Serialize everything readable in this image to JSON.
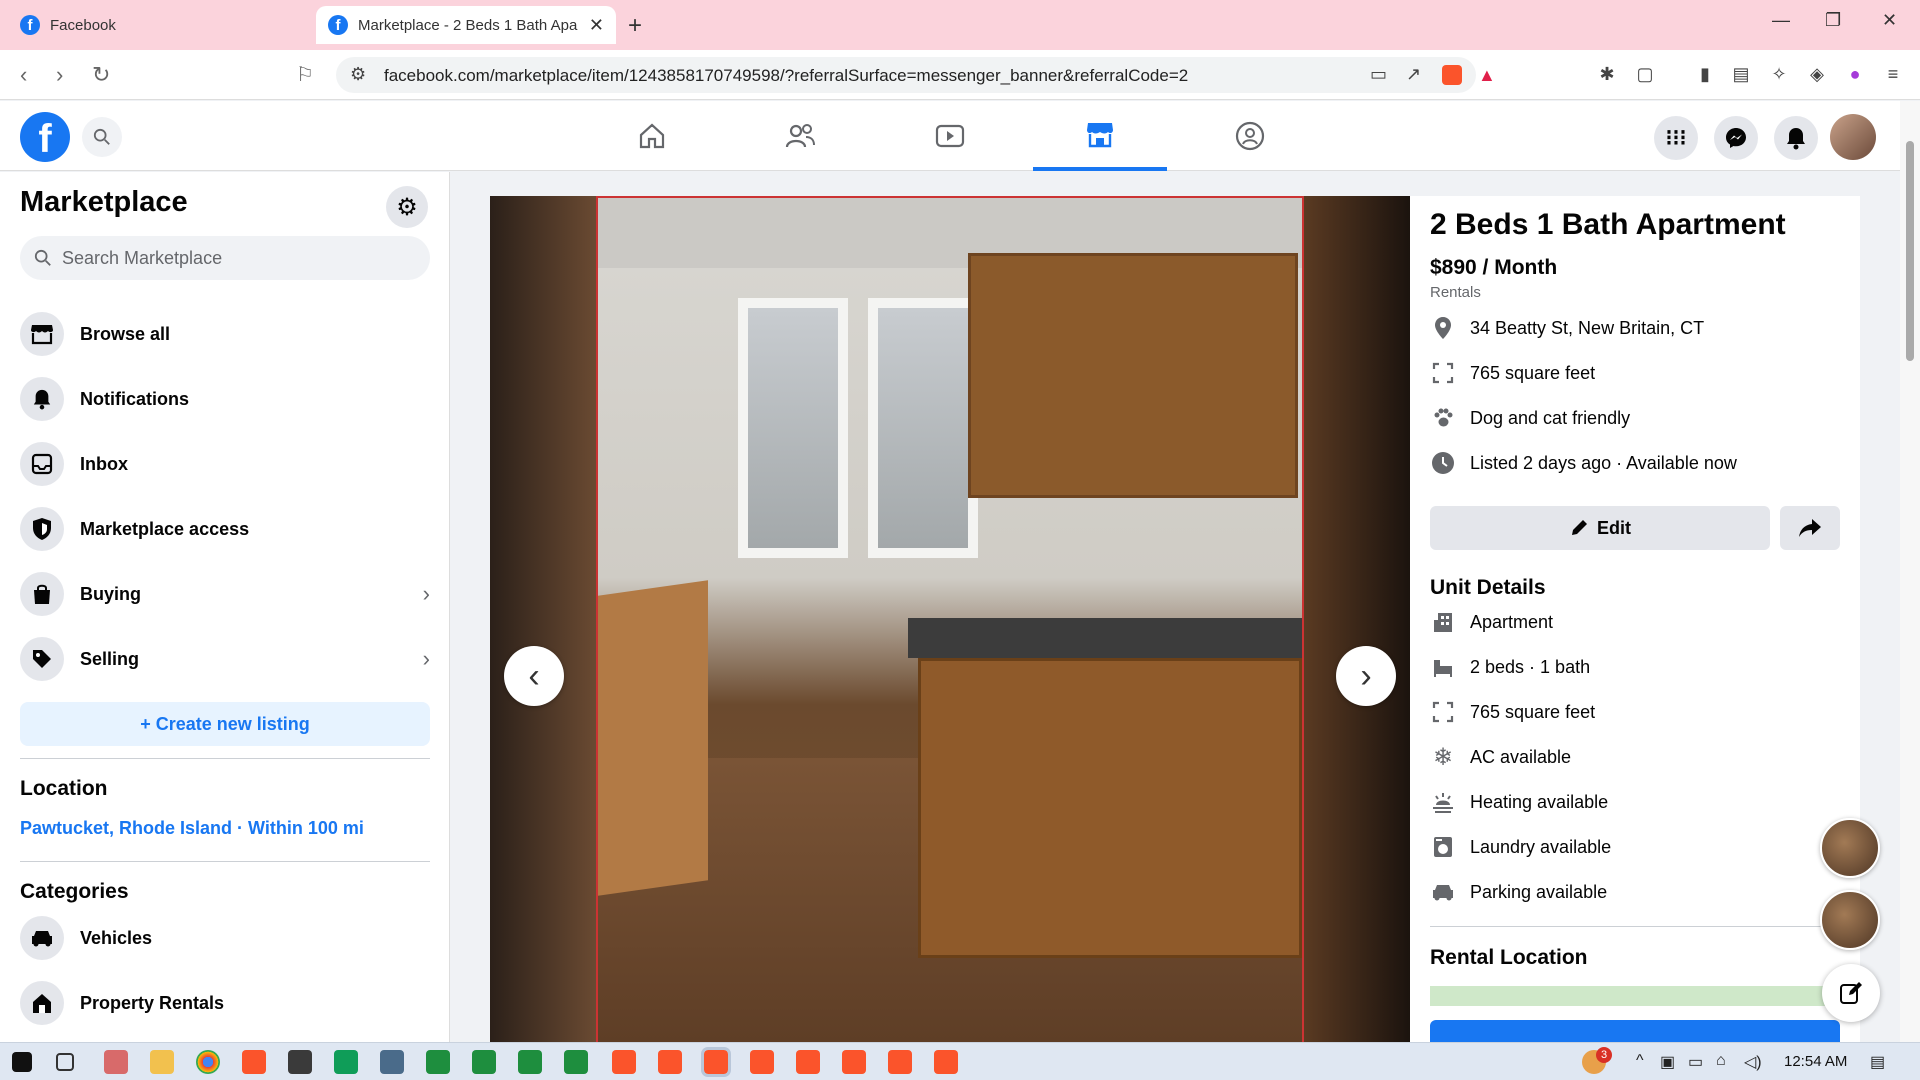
{
  "browser": {
    "tabs": [
      {
        "title": "Facebook",
        "active": false
      },
      {
        "title": "Marketplace - 2 Beds 1 Bath Apa",
        "active": true
      }
    ],
    "url": "facebook.com/marketplace/item/1243858170749598/?referralSurface=messenger_banner&referralCode=2"
  },
  "sidebar": {
    "title": "Marketplace",
    "search_placeholder": "Search Marketplace",
    "items": [
      {
        "label": "Browse all",
        "icon": "storefront-icon"
      },
      {
        "label": "Notifications",
        "icon": "bell-icon"
      },
      {
        "label": "Inbox",
        "icon": "inbox-icon"
      },
      {
        "label": "Marketplace access",
        "icon": "shield-icon"
      },
      {
        "label": "Buying",
        "icon": "bag-icon"
      },
      {
        "label": "Selling",
        "icon": "tag-icon"
      }
    ],
    "create_listing": "+ Create new listing",
    "location_heading": "Location",
    "location_value": "Pawtucket, Rhode Island · Within 100 mi",
    "categories_heading": "Categories",
    "categories": [
      {
        "label": "Vehicles",
        "icon": "car-icon"
      },
      {
        "label": "Property Rentals",
        "icon": "house-icon"
      }
    ]
  },
  "listing": {
    "title": "2 Beds 1 Bath Apartment",
    "price": "$890 / Month",
    "category": "Rentals",
    "facts": [
      {
        "text": "34 Beatty St, New Britain, CT",
        "icon": "location-pin-icon"
      },
      {
        "text": "765 square feet",
        "icon": "area-icon"
      },
      {
        "text": "Dog and cat friendly",
        "icon": "paw-icon"
      },
      {
        "text": "Listed 2 days ago · Available now",
        "icon": "clock-icon"
      }
    ],
    "edit_label": "Edit",
    "unit_details_heading": "Unit Details",
    "unit_details": [
      {
        "text": "Apartment",
        "icon": "building-icon"
      },
      {
        "text": "2 beds · 1 bath",
        "icon": "bed-icon"
      },
      {
        "text": "765 square feet",
        "icon": "area-icon"
      },
      {
        "text": "AC available",
        "icon": "snowflake-icon"
      },
      {
        "text": "Heating available",
        "icon": "heat-icon"
      },
      {
        "text": "Laundry available",
        "icon": "washer-icon"
      },
      {
        "text": "Parking available",
        "icon": "car-icon"
      }
    ],
    "rental_location_heading": "Rental Location"
  },
  "taskbar": {
    "time": "12:54 AM",
    "notification_badge": "3"
  },
  "colors": {
    "fb_blue": "#1877f2",
    "tabbar_pink": "#fbd3dc"
  }
}
